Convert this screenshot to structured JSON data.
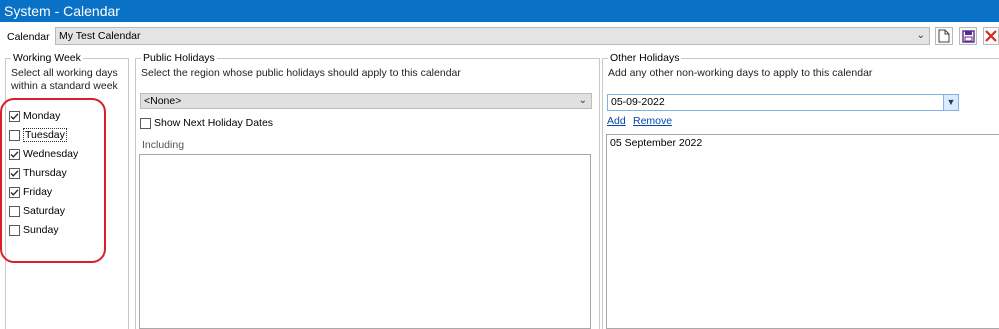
{
  "window": {
    "title": "System - Calendar"
  },
  "calendar": {
    "label": "Calendar",
    "selected": "My Test Calendar"
  },
  "toolbar": {
    "new_icon": "new-document-icon",
    "save_icon": "save-icon",
    "delete_icon": "delete-icon"
  },
  "working_week": {
    "title": "Working Week",
    "description_line1": "Select all working days",
    "description_line2": "within a standard week",
    "days": [
      {
        "label": "Monday",
        "checked": true
      },
      {
        "label": "Tuesday",
        "checked": false
      },
      {
        "label": "Wednesday",
        "checked": true
      },
      {
        "label": "Thursday",
        "checked": true
      },
      {
        "label": "Friday",
        "checked": true
      },
      {
        "label": "Saturday",
        "checked": false
      },
      {
        "label": "Sunday",
        "checked": false
      }
    ]
  },
  "public_holidays": {
    "title": "Public Holidays",
    "description": "Select the region whose public holidays should apply to this calendar",
    "region": "<None>",
    "show_next_label": "Show Next Holiday Dates",
    "show_next_checked": false,
    "including_label": "Including"
  },
  "other_holidays": {
    "title": "Other Holidays",
    "description": "Add any other non-working days to apply to this calendar",
    "date_value": "05-09-2022",
    "add_label": "Add",
    "remove_label": "Remove",
    "items": [
      "05 September 2022"
    ]
  },
  "colors": {
    "titlebar": "#0a72c6",
    "highlight": "#d7202a",
    "link": "#0645ad"
  }
}
